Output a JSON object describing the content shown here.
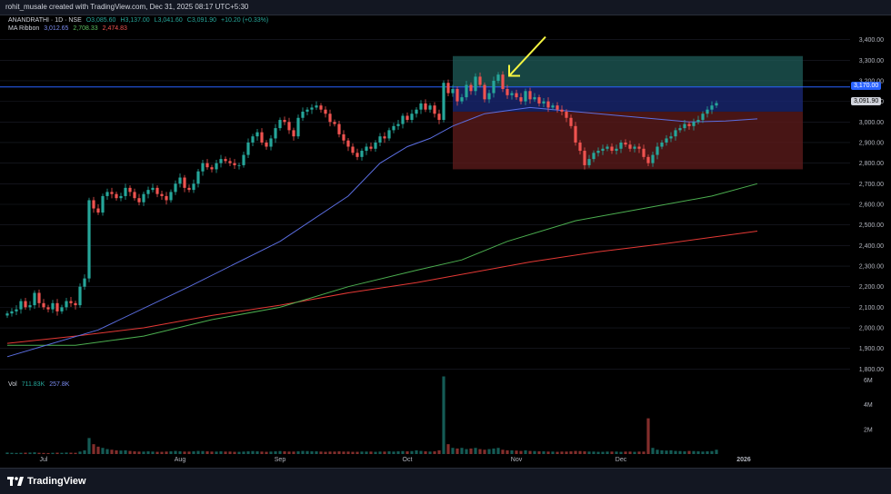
{
  "header": {
    "attribution": "rohit_musale created with TradingView.com, Dec 31, 2025 08:17 UTC+5:30"
  },
  "legend": {
    "symbol": "ANANDRATHI · 1D · NSE",
    "ohlc": [
      "O3,085.60",
      "H3,137.00",
      "L3,041.60",
      "C3,091.90"
    ],
    "change": "+10.20 (+0.33%)",
    "ma_title": "MA Ribbon",
    "ma_values": [
      "3,012.65",
      "2,708.33",
      "2,474.83"
    ],
    "vol_title": "Vol",
    "vol_values": [
      "711.83K",
      "257.8K"
    ]
  },
  "price_labels": {
    "level_line": "3,170.00",
    "last_price": "3,091.90"
  },
  "footer": {
    "brand": "TradingView",
    "year_label": "2026"
  },
  "colors": {
    "bull": "#26a69a",
    "bear": "#ef5350",
    "ma_fast": "#5b6ee1",
    "ma_mid": "#4caf50",
    "ma_slow": "#e53935",
    "level_line": "#2962ff",
    "arrow": "#f5f542",
    "zone_top": "#1f5c5a",
    "zone_mid": "#1b2a7a",
    "zone_bottom": "#5a1a1a"
  },
  "chart_data": {
    "type": "candlestick",
    "x_labels": [
      "Jul",
      "Aug",
      "Sep",
      "Oct",
      "Nov",
      "Dec",
      "2026"
    ],
    "y_ticks": [
      1800,
      1900,
      2000,
      2100,
      2200,
      2300,
      2400,
      2500,
      2600,
      2700,
      2800,
      2900,
      3000,
      3100,
      3200,
      3300,
      3400
    ],
    "y_tick_labels": [
      "1,800.00",
      "1,900.00",
      "2,000.00",
      "2,100.00",
      "2,200.00",
      "2,300.00",
      "2,400.00",
      "2,500.00",
      "2,600.00",
      "2,700.00",
      "2,800.00",
      "2,900.00",
      "3,000.00",
      "3,100.00",
      "3,200.00",
      "3,300.00",
      "3,400.00"
    ],
    "ylim": [
      1740,
      3460
    ],
    "vol_ticks": [
      "2M",
      "4M",
      "6M"
    ],
    "vol_tick_values": [
      2,
      4,
      6
    ],
    "level": 3170,
    "zone": {
      "start": 98,
      "end": 175,
      "top": 3320,
      "mid": 3170,
      "inner": 3050,
      "bottom": 2770
    },
    "ma_fast": [
      [
        0,
        1860
      ],
      [
        20,
        1990
      ],
      [
        40,
        2200
      ],
      [
        60,
        2420
      ],
      [
        75,
        2640
      ],
      [
        82,
        2800
      ],
      [
        88,
        2880
      ],
      [
        93,
        2920
      ],
      [
        98,
        2980
      ],
      [
        105,
        3040
      ],
      [
        115,
        3070
      ],
      [
        125,
        3050
      ],
      [
        140,
        3020
      ],
      [
        150,
        3000
      ],
      [
        158,
        3005
      ],
      [
        165,
        3015
      ]
    ],
    "ma_mid": [
      [
        0,
        1915
      ],
      [
        15,
        1915
      ],
      [
        30,
        1960
      ],
      [
        45,
        2040
      ],
      [
        60,
        2100
      ],
      [
        75,
        2200
      ],
      [
        90,
        2280
      ],
      [
        100,
        2330
      ],
      [
        110,
        2420
      ],
      [
        125,
        2520
      ],
      [
        140,
        2580
      ],
      [
        155,
        2640
      ],
      [
        165,
        2700
      ]
    ],
    "ma_slow": [
      [
        0,
        1925
      ],
      [
        15,
        1960
      ],
      [
        30,
        2000
      ],
      [
        45,
        2060
      ],
      [
        60,
        2110
      ],
      [
        75,
        2170
      ],
      [
        90,
        2220
      ],
      [
        100,
        2260
      ],
      [
        115,
        2320
      ],
      [
        130,
        2370
      ],
      [
        145,
        2410
      ],
      [
        165,
        2470
      ]
    ],
    "candles_close": [
      2070,
      2080,
      2090,
      2130,
      2100,
      2110,
      2170,
      2120,
      2100,
      2090,
      2120,
      2080,
      2100,
      2130,
      2120,
      2110,
      2200,
      2240,
      2620,
      2580,
      2560,
      2640,
      2660,
      2650,
      2630,
      2640,
      2680,
      2660,
      2630,
      2610,
      2650,
      2670,
      2680,
      2650,
      2640,
      2620,
      2660,
      2700,
      2730,
      2680,
      2670,
      2700,
      2760,
      2800,
      2780,
      2770,
      2800,
      2820,
      2810,
      2800,
      2790,
      2790,
      2840,
      2900,
      2930,
      2950,
      2900,
      2880,
      2920,
      2970,
      3010,
      3000,
      2960,
      2930,
      3020,
      3050,
      3060,
      3070,
      3080,
      3060,
      3040,
      3000,
      2990,
      2940,
      2910,
      2880,
      2850,
      2830,
      2860,
      2880,
      2870,
      2900,
      2930,
      2920,
      2960,
      2980,
      2990,
      3030,
      3010,
      3040,
      3060,
      3090,
      3060,
      3080,
      3040,
      3010,
      3190,
      3140,
      3160,
      3100,
      3120,
      3180,
      3150,
      3220,
      3180,
      3110,
      3140,
      3200,
      3230,
      3160,
      3130,
      3140,
      3120,
      3100,
      3150,
      3110,
      3120,
      3090,
      3100,
      3070,
      3080,
      3060,
      3050,
      3020,
      2980,
      2900,
      2860,
      2790,
      2820,
      2850,
      2860,
      2870,
      2880,
      2860,
      2870,
      2900,
      2890,
      2870,
      2880,
      2870,
      2830,
      2800,
      2840,
      2880,
      2900,
      2920,
      2930,
      2960,
      2970,
      2990,
      2980,
      3000,
      3010,
      3040,
      3060,
      3080,
      3091.9
    ],
    "volume": [
      0.12,
      0.1,
      0.09,
      0.1,
      0.11,
      0.12,
      0.14,
      0.1,
      0.09,
      0.08,
      0.1,
      0.11,
      0.1,
      0.12,
      0.11,
      0.1,
      0.2,
      0.3,
      1.3,
      0.8,
      0.6,
      0.5,
      0.4,
      0.35,
      0.3,
      0.28,
      0.3,
      0.25,
      0.22,
      0.2,
      0.2,
      0.22,
      0.2,
      0.18,
      0.18,
      0.2,
      0.22,
      0.25,
      0.22,
      0.2,
      0.2,
      0.22,
      0.25,
      0.24,
      0.22,
      0.2,
      0.2,
      0.22,
      0.2,
      0.2,
      0.18,
      0.18,
      0.2,
      0.22,
      0.24,
      0.22,
      0.2,
      0.18,
      0.2,
      0.22,
      0.24,
      0.22,
      0.2,
      0.2,
      0.22,
      0.25,
      0.24,
      0.22,
      0.22,
      0.2,
      0.18,
      0.2,
      0.2,
      0.22,
      0.2,
      0.2,
      0.18,
      0.18,
      0.2,
      0.2,
      0.2,
      0.18,
      0.2,
      0.2,
      0.22,
      0.2,
      0.22,
      0.24,
      0.22,
      0.24,
      0.3,
      0.25,
      0.22,
      0.2,
      0.22,
      0.3,
      6.3,
      0.8,
      0.5,
      0.45,
      0.5,
      0.4,
      0.45,
      0.5,
      0.4,
      0.35,
      0.4,
      0.45,
      0.5,
      0.35,
      0.3,
      0.3,
      0.28,
      0.25,
      0.3,
      0.25,
      0.24,
      0.22,
      0.22,
      0.2,
      0.2,
      0.18,
      0.2,
      0.2,
      0.22,
      0.25,
      0.24,
      0.22,
      0.2,
      0.2,
      0.18,
      0.18,
      0.2,
      0.2,
      0.2,
      0.18,
      0.2,
      0.2,
      0.18,
      0.2,
      0.2,
      2.9,
      0.5,
      0.35,
      0.3,
      0.28,
      0.3,
      0.25,
      0.24,
      0.22,
      0.25,
      0.24,
      0.22,
      0.2,
      0.22,
      0.24,
      0.35,
      0.7
    ]
  }
}
